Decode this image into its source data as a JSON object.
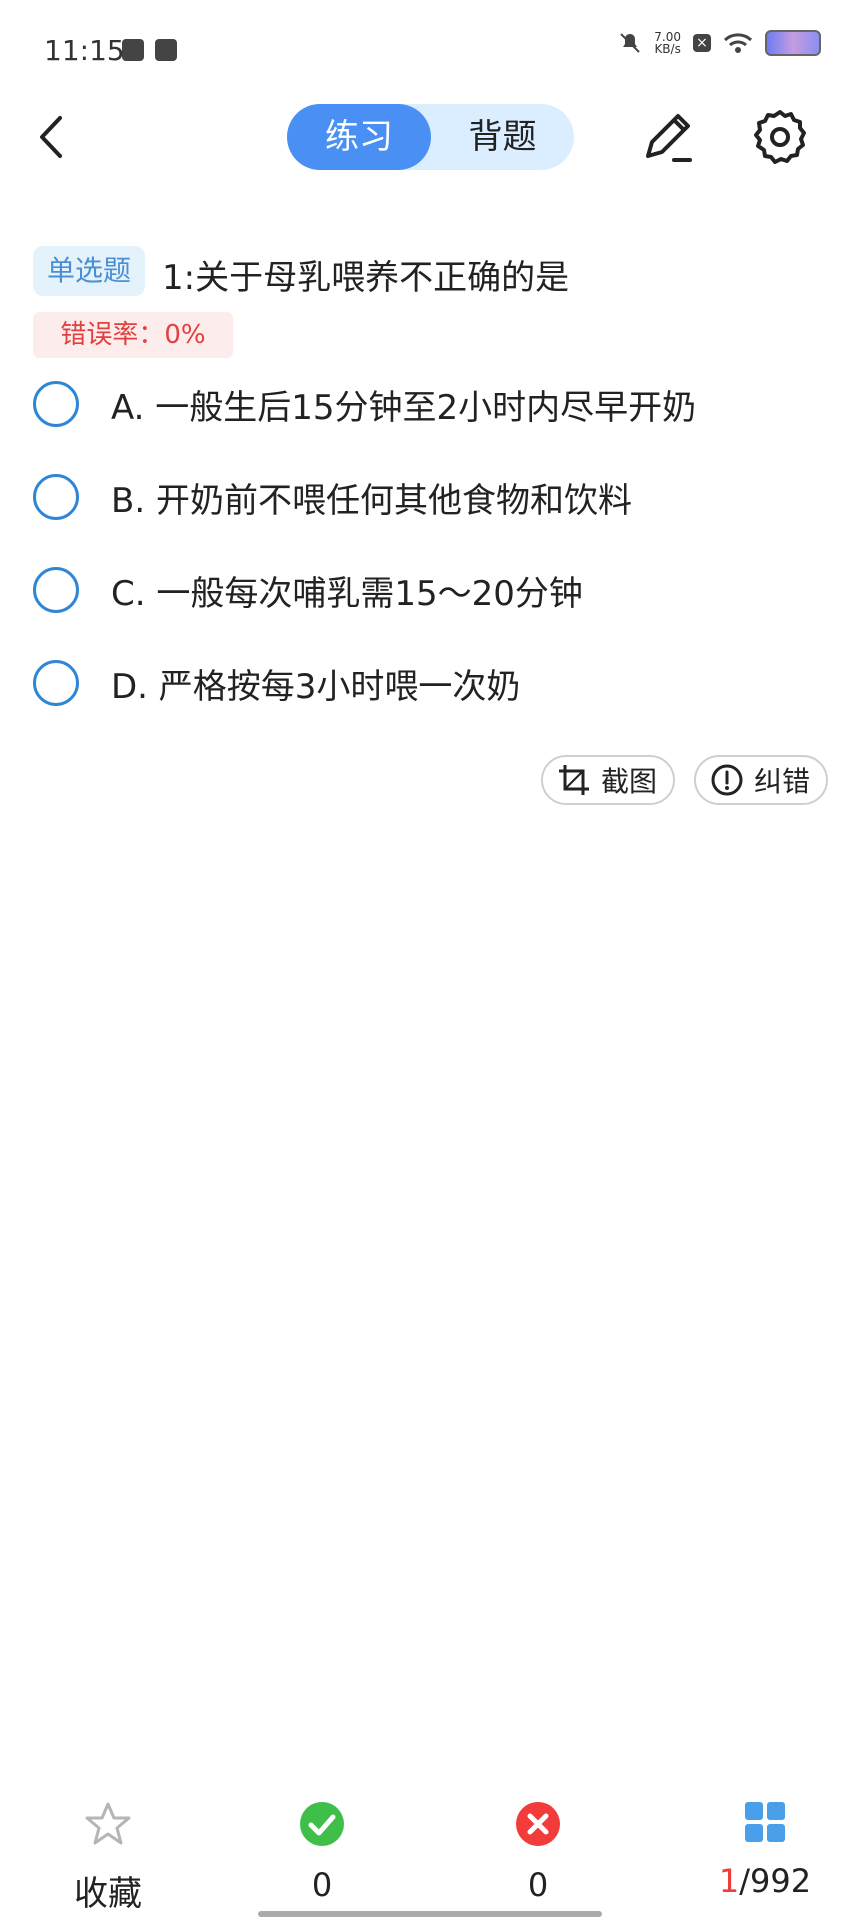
{
  "status_bar": {
    "time": "11:15",
    "net_speed_value": "7.00",
    "net_speed_unit": "KB/s"
  },
  "header": {
    "tabs": [
      {
        "label": "练习",
        "active": true
      },
      {
        "label": "背题",
        "active": false
      }
    ]
  },
  "question": {
    "type_badge": "单选题",
    "title": "1:关于母乳喂养不正确的是",
    "error_rate": "错误率：0%",
    "options": [
      {
        "label": "A. 一般生后15分钟至2小时内尽早开奶"
      },
      {
        "label": "B. 开奶前不喂任何其他食物和饮料"
      },
      {
        "label": "C. 一般每次哺乳需15～20分钟"
      },
      {
        "label": "D. 严格按每3小时喂一次奶"
      }
    ]
  },
  "actions": {
    "screenshot_label": "截图",
    "report_label": "纠错"
  },
  "bottom_bar": {
    "favorite_label": "收藏",
    "correct_count": "0",
    "wrong_count": "0",
    "current_index": "1",
    "total": "/992"
  },
  "colors": {
    "accent": "#4a8ff3",
    "correct": "#3fbf4a",
    "wrong": "#f23b3b",
    "grid": "#4a9fea",
    "error_text": "#e0403f"
  }
}
